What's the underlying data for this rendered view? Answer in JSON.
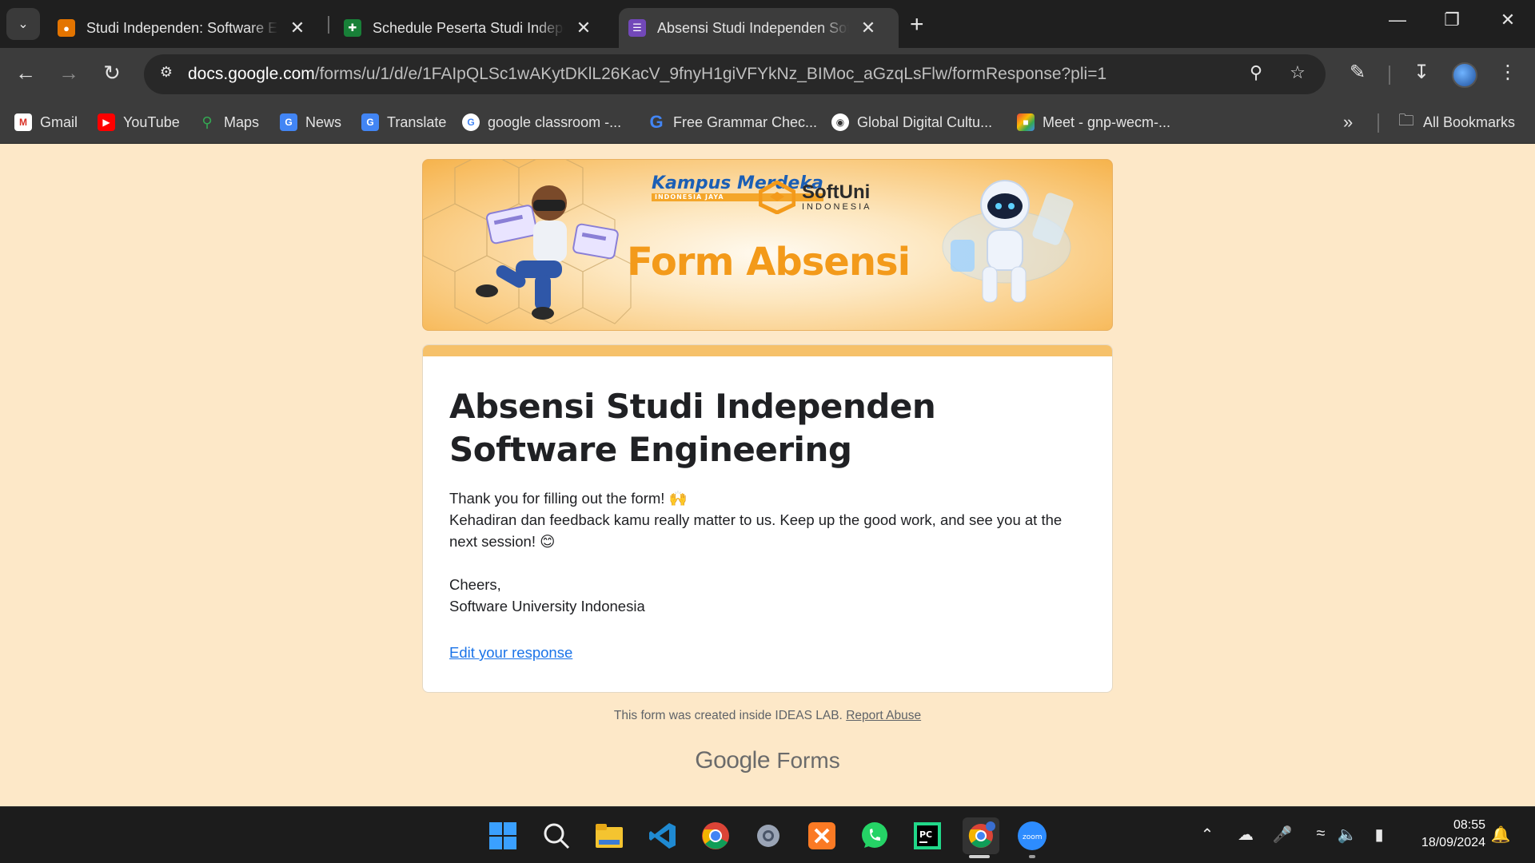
{
  "browser": {
    "tabs": [
      {
        "title": "Studi Independen: Software Eng",
        "icon": "classroom-icon",
        "color": "#e37400"
      },
      {
        "title": "Schedule Peserta Studi Indepen",
        "icon": "sheets-icon",
        "color": "#188038"
      },
      {
        "title": "Absensi Studi Independen Softw",
        "icon": "forms-icon",
        "color": "#7248b9",
        "active": true
      }
    ],
    "new_tab_label": "+",
    "address": {
      "host": "docs.google.com",
      "path": "/forms/u/1/d/e/1FAIpQLSc1wAKytDKlL26KacV_9fnyH1giVFYkNz_BIMoc_aGzqLsFlw/formResponse?pli=1"
    },
    "bookmarks": [
      {
        "label": "Gmail",
        "icon": "gmail-icon"
      },
      {
        "label": "YouTube",
        "icon": "youtube-icon"
      },
      {
        "label": "Maps",
        "icon": "maps-icon"
      },
      {
        "label": "News",
        "icon": "news-icon"
      },
      {
        "label": "Translate",
        "icon": "translate-icon"
      },
      {
        "label": "google classroom -...",
        "icon": "google-icon"
      },
      {
        "label": "Free Grammar Chec...",
        "icon": "grammar-icon"
      },
      {
        "label": "Global Digital Cultu...",
        "icon": "globe-icon"
      },
      {
        "label": "Meet - gnp-wecm-...",
        "icon": "meet-icon"
      }
    ],
    "all_bookmarks_label": "All Bookmarks"
  },
  "banner": {
    "brand_kampus": "Kampus Merdeka",
    "brand_kampus_sub": "INDONESIA JAYA",
    "brand_softuni": "SoftUni",
    "brand_softuni_sub": "INDONESIA",
    "title": "Form Absensi"
  },
  "form": {
    "title": "Absensi Studi Independen Software Engineering",
    "message_line1": "Thank you for filling out the form! 🙌",
    "message_line2": "Kehadiran dan feedback kamu really matter to us. Keep up the good work, and see you at the next session! 😊",
    "signoff": "Cheers,",
    "signature": "Software University Indonesia",
    "edit_link": "Edit your response",
    "accent_color": "#f6c16a"
  },
  "footer": {
    "note": "This form was created inside IDEAS LAB.",
    "report_link": "Report Abuse",
    "brand_google": "Google",
    "brand_forms": "Forms"
  },
  "taskbar": {
    "apps": [
      "windows-start-icon",
      "search-icon",
      "file-explorer-icon",
      "vscode-icon",
      "chrome-icon",
      "settings-icon",
      "xampp-icon",
      "whatsapp-icon",
      "pycharm-icon",
      "chrome-profile-icon",
      "zoom-icon"
    ],
    "time": "08:55",
    "date": "18/09/2024"
  }
}
